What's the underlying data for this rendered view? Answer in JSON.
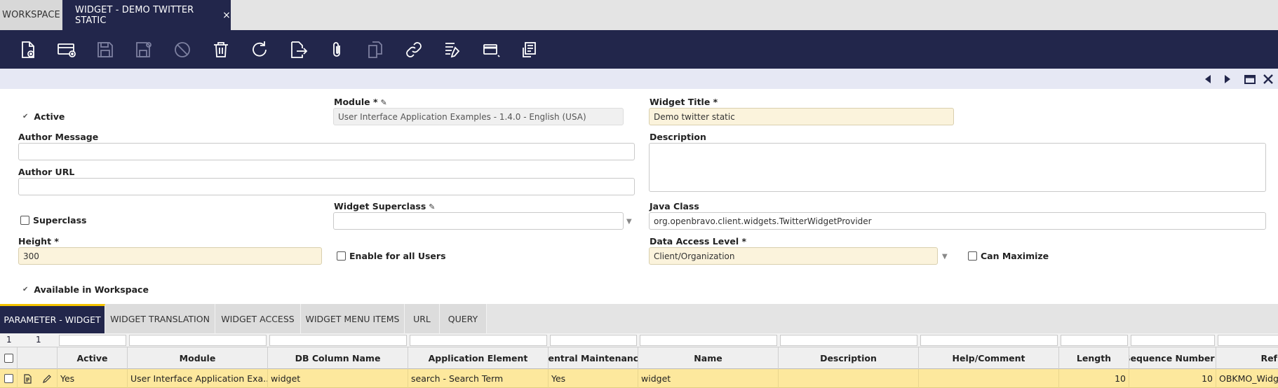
{
  "tabs": {
    "workspace": "WORKSPACE",
    "active_label": "WIDGET - DEMO TWITTER STATIC",
    "close": "×"
  },
  "toolbar": {
    "buttons": [
      "new-document",
      "new-row",
      "save",
      "save-and-close",
      "undo",
      "delete",
      "refresh",
      "export",
      "attach",
      "clone",
      "link",
      "audit-trail",
      "grid-form-toggle",
      "print-record"
    ]
  },
  "form": {
    "active_label": "Active",
    "module_label": "Module *",
    "module_value": "User Interface Application Examples - 1.4.0 - English (USA)",
    "widget_title_label": "Widget Title *",
    "widget_title_value": "Demo twitter static",
    "author_message_label": "Author Message",
    "author_message_value": "",
    "description_label": "Description",
    "description_value": "",
    "author_url_label": "Author URL",
    "author_url_value": "",
    "superclass_label": "Superclass",
    "widget_superclass_label": "Widget Superclass",
    "widget_superclass_value": "",
    "java_class_label": "Java Class",
    "java_class_value": "org.openbravo.client.widgets.TwitterWidgetProvider",
    "height_label": "Height *",
    "height_value": "300",
    "enable_all_users_label": "Enable for all Users",
    "data_access_label": "Data Access Level *",
    "data_access_value": "Client/Organization",
    "can_maximize_label": "Can Maximize",
    "available_label": "Available in Workspace"
  },
  "subtabs": [
    "PARAMETER - WIDGET",
    "WIDGET TRANSLATION",
    "WIDGET ACCESS",
    "WIDGET MENU ITEMS",
    "URL",
    "QUERY"
  ],
  "grid": {
    "count_left": "1",
    "count_right": "1",
    "headers": [
      "Active",
      "Module",
      "DB Column Name",
      "Application Element",
      "Central Maintenance",
      "Name",
      "Description",
      "Help/Comment",
      "Length",
      "Sequence Number",
      "Ref"
    ],
    "sort_indicator": "▲",
    "row": {
      "active": "Yes",
      "module": "User Interface Application Exa...",
      "db_column": "widget",
      "app_element": "search - Search Term",
      "central": "Yes",
      "name": "widget",
      "description": "",
      "help": "",
      "length": "10",
      "sequence": "10",
      "ref": "OBKMO_Widg"
    }
  },
  "colors": {
    "navy": "#22264b",
    "required_field": "#fbf3dc",
    "selected_row": "#fde89d",
    "active_tab_accent": "#f3c300"
  }
}
